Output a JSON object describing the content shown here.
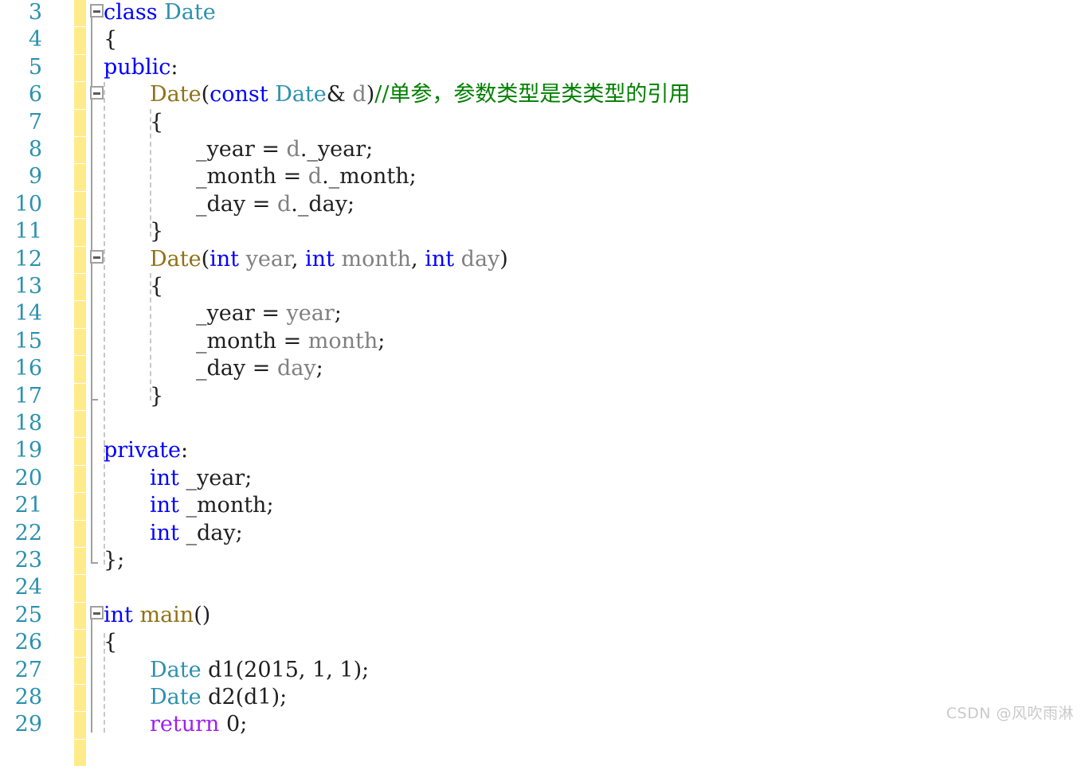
{
  "editor": {
    "language": "C++",
    "first_line_number": 3,
    "line_height": 34.4,
    "colors": {
      "background": "#FFFFFF",
      "line_number": "#2B91AF",
      "keyword": "#0000FF",
      "user_type": "#2B91AF",
      "function_name": "#8F7214",
      "parameter": "#808080",
      "comment": "#008000",
      "control_keyword": "#A020F0",
      "plain_text": "#1F1F1F",
      "change_bar": "#FFE97F",
      "outlining": "#A0A0A0",
      "indent_guide": "#C8C8C8"
    }
  },
  "line_numbers": [
    "3",
    "4",
    "5",
    "6",
    "7",
    "8",
    "9",
    "10",
    "11",
    "12",
    "13",
    "14",
    "15",
    "16",
    "17",
    "18",
    "19",
    "20",
    "21",
    "22",
    "23",
    "24",
    "25",
    "26",
    "27",
    "28",
    "29"
  ],
  "code_lines": [
    {
      "number": "3",
      "indent": 0,
      "text": "class Date"
    },
    {
      "number": "4",
      "indent": 0,
      "text": "{"
    },
    {
      "number": "5",
      "indent": 0,
      "text": "public:"
    },
    {
      "number": "6",
      "indent": 1,
      "text": "Date(const Date& d)//单参，参数类型是类类型的引用"
    },
    {
      "number": "7",
      "indent": 1,
      "text": "{"
    },
    {
      "number": "8",
      "indent": 2,
      "text": "_year = d._year;"
    },
    {
      "number": "9",
      "indent": 2,
      "text": "_month = d._month;"
    },
    {
      "number": "10",
      "indent": 2,
      "text": "_day = d._day;"
    },
    {
      "number": "11",
      "indent": 1,
      "text": "}"
    },
    {
      "number": "12",
      "indent": 1,
      "text": "Date(int year, int month, int day)"
    },
    {
      "number": "13",
      "indent": 1,
      "text": "{"
    },
    {
      "number": "14",
      "indent": 2,
      "text": "_year = year;"
    },
    {
      "number": "15",
      "indent": 2,
      "text": "_month = month;"
    },
    {
      "number": "16",
      "indent": 2,
      "text": "_day = day;"
    },
    {
      "number": "17",
      "indent": 1,
      "text": "}"
    },
    {
      "number": "18",
      "indent": 0,
      "text": ""
    },
    {
      "number": "19",
      "indent": 0,
      "text": "private:"
    },
    {
      "number": "20",
      "indent": 1,
      "text": "int _year;"
    },
    {
      "number": "21",
      "indent": 1,
      "text": "int _month;"
    },
    {
      "number": "22",
      "indent": 1,
      "text": "int _day;"
    },
    {
      "number": "23",
      "indent": 0,
      "text": "};"
    },
    {
      "number": "24",
      "indent": 0,
      "text": ""
    },
    {
      "number": "25",
      "indent": 0,
      "text": "int main()"
    },
    {
      "number": "26",
      "indent": 0,
      "text": "{"
    },
    {
      "number": "27",
      "indent": 1,
      "text": "Date d1(2015, 1, 1);"
    },
    {
      "number": "28",
      "indent": 1,
      "text": "Date d2(d1);"
    },
    {
      "number": "29",
      "indent": 1,
      "text": "return 0;"
    }
  ],
  "tokens": {
    "l3": [
      [
        "class ",
        "kw"
      ],
      [
        "Date",
        "type"
      ]
    ],
    "l4": [
      [
        "{",
        "punct"
      ]
    ],
    "l5": [
      [
        "public",
        "kw"
      ],
      [
        ":",
        "punct"
      ]
    ],
    "l6": [
      [
        "Date",
        "func"
      ],
      [
        "(",
        "punct"
      ],
      [
        "const ",
        "kw"
      ],
      [
        "Date",
        "type"
      ],
      [
        "& ",
        "punct"
      ],
      [
        "d",
        "param"
      ],
      [
        ")",
        "punct"
      ],
      [
        "//单参，参数类型是类类型的引用",
        "comment"
      ]
    ],
    "l7": [
      [
        "{",
        "punct"
      ]
    ],
    "l8": [
      [
        "_year = ",
        "plain"
      ],
      [
        "d",
        "var"
      ],
      [
        "._year;",
        "plain"
      ]
    ],
    "l9": [
      [
        "_month = ",
        "plain"
      ],
      [
        "d",
        "var"
      ],
      [
        "._month;",
        "plain"
      ]
    ],
    "l10": [
      [
        "_day = ",
        "plain"
      ],
      [
        "d",
        "var"
      ],
      [
        "._day;",
        "plain"
      ]
    ],
    "l11": [
      [
        "}",
        "punct"
      ]
    ],
    "l12": [
      [
        "Date",
        "func"
      ],
      [
        "(",
        "punct"
      ],
      [
        "int ",
        "kw"
      ],
      [
        "year",
        "param"
      ],
      [
        ", ",
        "punct"
      ],
      [
        "int ",
        "kw"
      ],
      [
        "month",
        "param"
      ],
      [
        ", ",
        "punct"
      ],
      [
        "int ",
        "kw"
      ],
      [
        "day",
        "param"
      ],
      [
        ")",
        "punct"
      ]
    ],
    "l13": [
      [
        "{",
        "punct"
      ]
    ],
    "l14": [
      [
        "_year = ",
        "plain"
      ],
      [
        "year",
        "param"
      ],
      [
        ";",
        "plain"
      ]
    ],
    "l15": [
      [
        "_month = ",
        "plain"
      ],
      [
        "month",
        "param"
      ],
      [
        ";",
        "plain"
      ]
    ],
    "l16": [
      [
        "_day = ",
        "plain"
      ],
      [
        "day",
        "param"
      ],
      [
        ";",
        "plain"
      ]
    ],
    "l17": [
      [
        "}",
        "punct"
      ]
    ],
    "l18": [],
    "l19": [
      [
        "private",
        "kw"
      ],
      [
        ":",
        "punct"
      ]
    ],
    "l20": [
      [
        "int",
        "kw"
      ],
      [
        " _year;",
        "plain"
      ]
    ],
    "l21": [
      [
        "int",
        "kw"
      ],
      [
        " _month;",
        "plain"
      ]
    ],
    "l22": [
      [
        "int",
        "kw"
      ],
      [
        " _day;",
        "plain"
      ]
    ],
    "l23": [
      [
        "};",
        "punct"
      ]
    ],
    "l24": [],
    "l25": [
      [
        "int ",
        "kw"
      ],
      [
        "main",
        "func"
      ],
      [
        "()",
        "punct"
      ]
    ],
    "l26": [
      [
        "{",
        "punct"
      ]
    ],
    "l27": [
      [
        "Date",
        "type"
      ],
      [
        " d1",
        "plain"
      ],
      [
        "(",
        "punct"
      ],
      [
        "2015",
        "num"
      ],
      [
        ", ",
        "punct"
      ],
      [
        "1",
        "num"
      ],
      [
        ", ",
        "punct"
      ],
      [
        "1",
        "num"
      ],
      [
        ");",
        "punct"
      ]
    ],
    "l28": [
      [
        "Date",
        "type"
      ],
      [
        " d2",
        "plain"
      ],
      [
        "(",
        "punct"
      ],
      [
        "d1",
        "plain"
      ],
      [
        ");",
        "punct"
      ]
    ],
    "l29": [
      [
        "return ",
        "ctrl"
      ],
      [
        "0",
        "num"
      ],
      [
        ";",
        "plain"
      ]
    ]
  },
  "outlining": {
    "regions": [
      {
        "name": "class-Date",
        "start_line": "3",
        "end_line": "23",
        "collapsed": false
      },
      {
        "name": "copy-constructor",
        "start_line": "6",
        "end_line": "11",
        "collapsed": false
      },
      {
        "name": "value-constructor",
        "start_line": "12",
        "end_line": "17",
        "collapsed": false
      },
      {
        "name": "main-function",
        "start_line": "25",
        "end_line": "29",
        "collapsed": false
      }
    ],
    "toggle_glyph": "minus"
  },
  "watermark": {
    "text": "CSDN @风吹雨淋"
  }
}
